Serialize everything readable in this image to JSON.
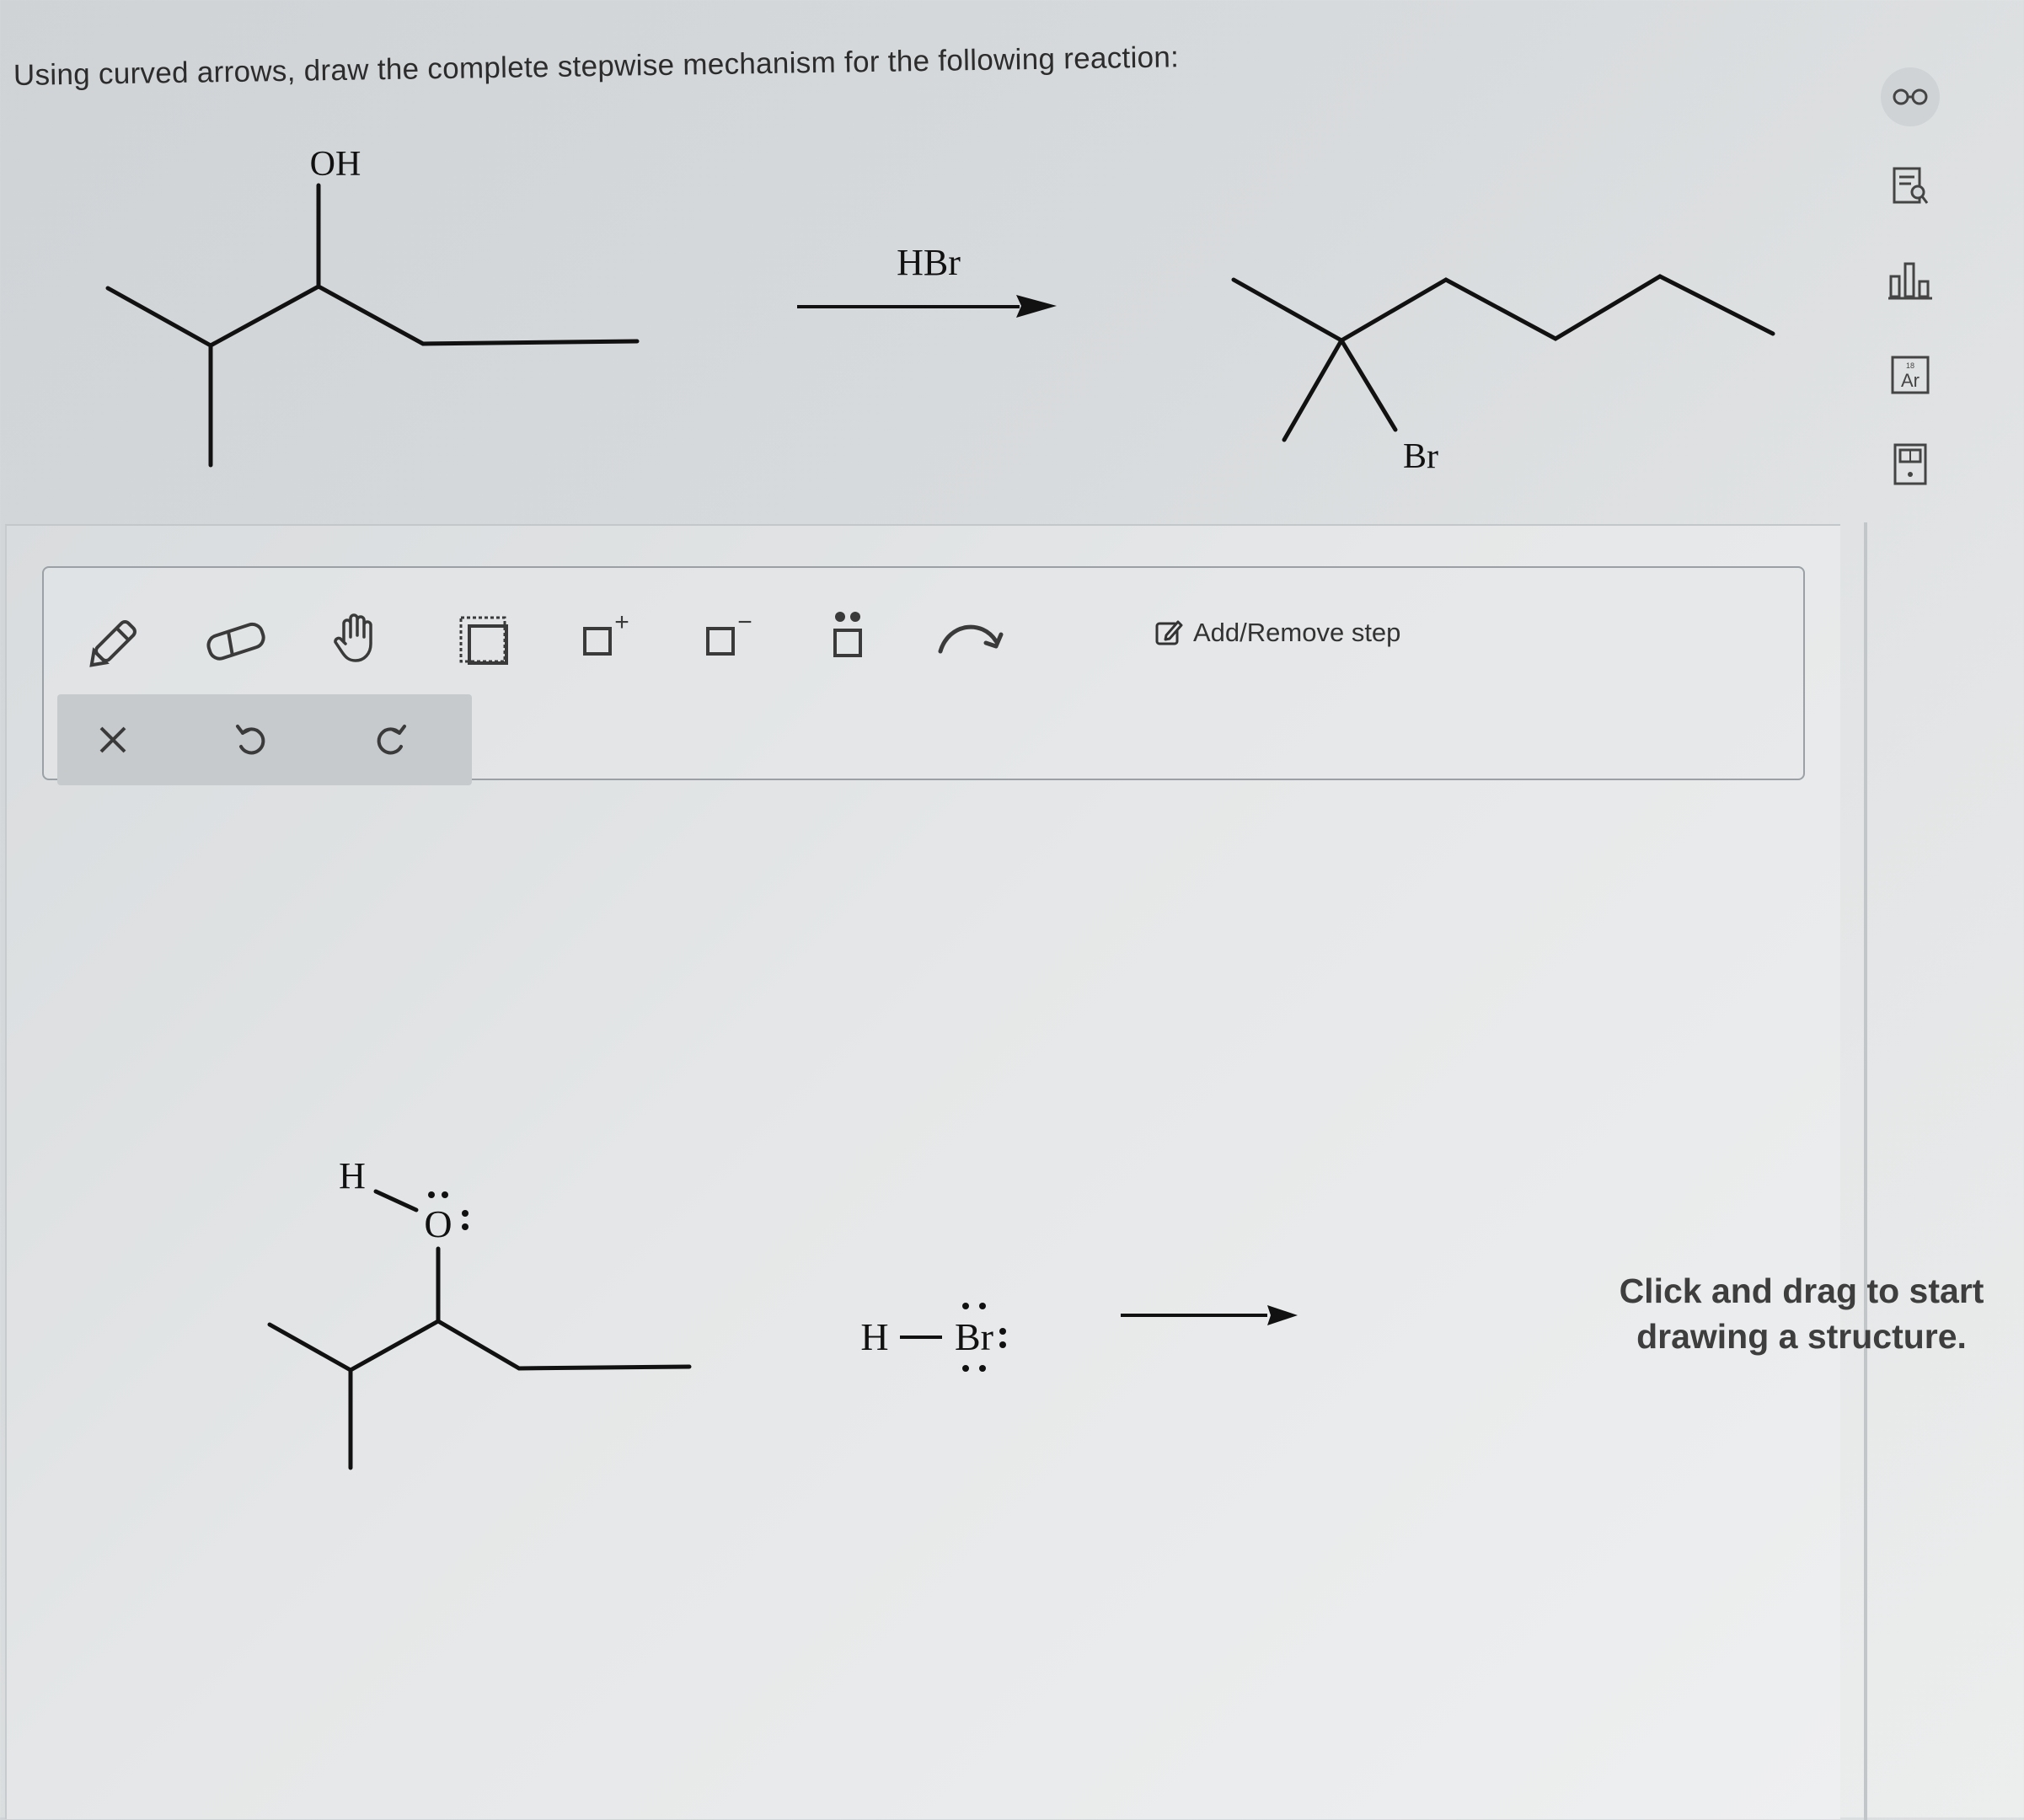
{
  "question": "Using curved arrows, draw the complete stepwise mechanism for the following reaction:",
  "reaction": {
    "reactant_oh_label": "OH",
    "reagent_label": "HBr",
    "product_br_label": "Br"
  },
  "side_icons": [
    "glasses-icon",
    "document-search-icon",
    "bar-chart-icon",
    "periodic-table-icon",
    "calculator-icon"
  ],
  "side_icon_text": {
    "periodic": "Ar"
  },
  "toolbar": {
    "tools": [
      "pencil-icon",
      "eraser-icon",
      "hand-icon",
      "selection-box-icon",
      "positive-charge-icon",
      "negative-charge-icon",
      "lone-pair-icon",
      "curved-arrow-icon"
    ],
    "positive_mark": "+",
    "negative_mark": "−",
    "add_remove_label": "Add/Remove step",
    "sub_tools": [
      "clear-icon",
      "undo-icon",
      "redo-icon"
    ]
  },
  "canvas": {
    "h_label": "H",
    "o_label": "O",
    "h2_label": "H",
    "br_label": "Br",
    "hint_line1": "Click and drag to start",
    "hint_line2": "drawing a structure."
  }
}
